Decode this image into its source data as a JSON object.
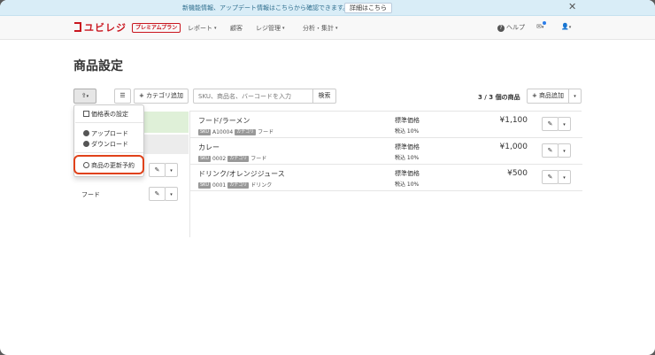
{
  "notice": {
    "text": "新機能情報、アップデート情報はこちらから確認できます。",
    "button": "詳細はこちら",
    "close": "✕"
  },
  "nav": {
    "logo": "ユビレジ",
    "premium": "プレミアムプラン",
    "items": [
      {
        "label": "レポート",
        "caret": "▾"
      },
      {
        "label": "顧客",
        "caret": ""
      },
      {
        "label": "レジ管理",
        "caret": "▾"
      },
      {
        "label": "分析・集計",
        "caret": "▾"
      }
    ],
    "help": "ヘルプ",
    "help_icon": "?",
    "mail_icon": "✉",
    "user_icon": "👤",
    "caret": "▾"
  },
  "page": {
    "title": "商品設定"
  },
  "toolbar": {
    "actions_icon": "⇪",
    "list_icon": "☰",
    "add_category": "カテゴリ追加",
    "search_placeholder": "SKU、商品名、バーコードを入力",
    "search_button": "検索",
    "count": "3 / 3 個の商品",
    "add_product": "商品追加",
    "plus": "+",
    "caret": "▾"
  },
  "dropdown": {
    "items": [
      {
        "label": "価格表の設定",
        "icon": "table-icon"
      },
      {
        "label": "アップロード",
        "icon": "upload-icon"
      },
      {
        "label": "ダウンロード",
        "icon": "download-icon"
      },
      {
        "label": "商品の更新予約",
        "icon": "clock-icon"
      }
    ]
  },
  "categories": {
    "items": [
      "フード"
    ]
  },
  "row_buttons": {
    "edit": "✎",
    "caret": "▾"
  },
  "products": [
    {
      "name": "フード/ラーメン",
      "sku_tag": "SKU",
      "sku": "A10004",
      "cat_tag": "カテゴリ",
      "category": "フード",
      "price_label": "標準価格",
      "tax": "税込 10%",
      "price": "¥1,100"
    },
    {
      "name": "カレー",
      "sku_tag": "SKU",
      "sku": "0002",
      "cat_tag": "カテゴリ",
      "category": "フード",
      "price_label": "標準価格",
      "tax": "税込 10%",
      "price": "¥1,000"
    },
    {
      "name": "ドリンク/オレンジジュース",
      "sku_tag": "SKU",
      "sku": "0001",
      "cat_tag": "カテゴリ",
      "category": "ドリンク",
      "price_label": "標準価格",
      "tax": "税込 10%",
      "price": "¥500"
    }
  ],
  "colors": {
    "brand": "#c9151e",
    "notice_bg": "#d9edf7",
    "selected_row": "#dff0d8",
    "highlight": "#e0421a"
  }
}
